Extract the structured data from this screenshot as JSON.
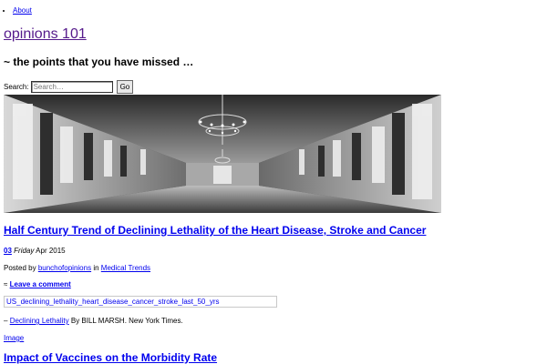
{
  "nav": {
    "about": "About"
  },
  "site": {
    "title": "opinions 101",
    "description": "~ the points that you have missed …"
  },
  "search": {
    "label": "Search:",
    "placeholder": "Search…",
    "button": "Go"
  },
  "posts": [
    {
      "title": "Half Century Trend of Declining Lethality of the Heart Disease, Stroke and Cancer",
      "date": {
        "day": "03",
        "weekday": "Friday",
        "month_year": "Apr 2015"
      },
      "posted_by_prefix": "Posted by",
      "author": "bunchofopinions",
      "in_word": "in",
      "category": "Medical Trends",
      "comment_bullet": "≈",
      "comment_link": "Leave a comment",
      "image_alt": "US_declining_lethality_heart_disease_cancer_stroke_last_50_yrs",
      "credit_prefix": "–",
      "credit_link": "Declining Lethality",
      "credit_suffix": "By BILL MARSH. New York Times.",
      "format_link": "Image"
    },
    {
      "title": "Impact of Vaccines on the Morbidity Rate"
    }
  ],
  "colors": {
    "link": "#0000ee",
    "visited": "#551a8b"
  },
  "banner_icon": "grayscale-palace-hall-chandelier-photo"
}
